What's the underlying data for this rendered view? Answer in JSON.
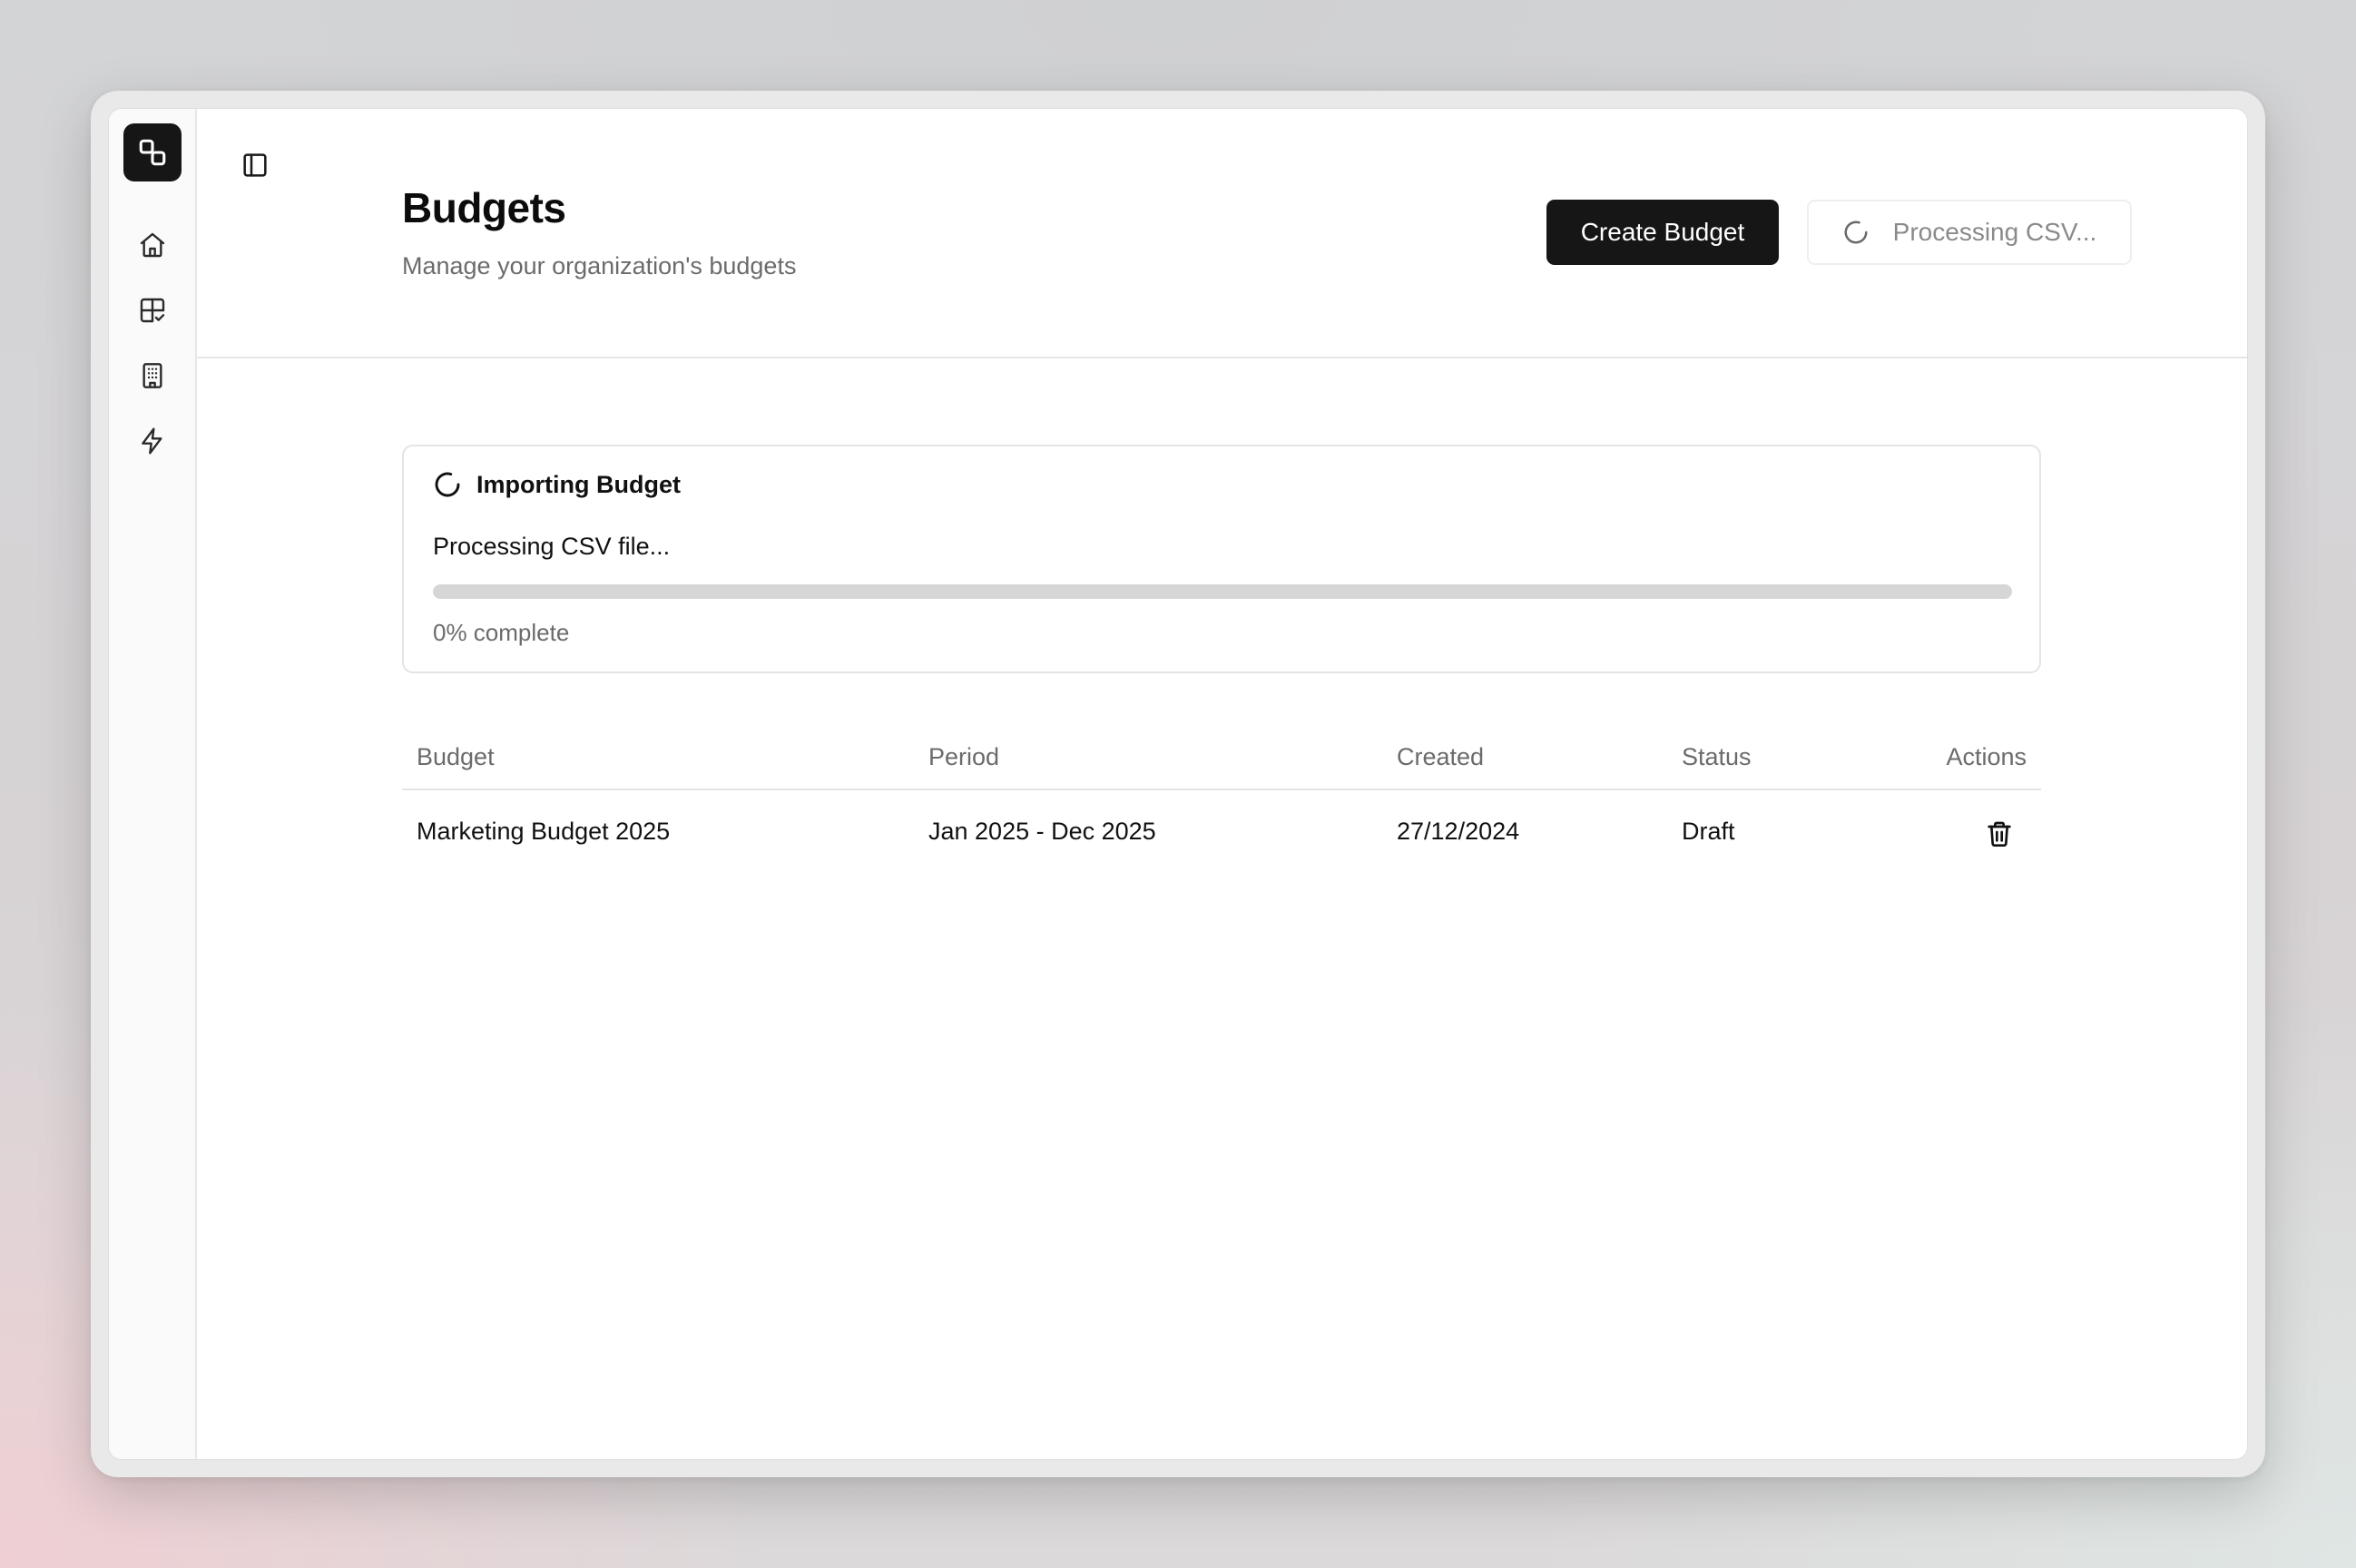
{
  "header": {
    "title": "Budgets",
    "subtitle": "Manage your organization's budgets",
    "create_label": "Create Budget",
    "processing_label": "Processing CSV..."
  },
  "nav": {
    "items": [
      {
        "name": "home",
        "icon": "home-icon"
      },
      {
        "name": "budgets",
        "icon": "layout-check-icon"
      },
      {
        "name": "organization",
        "icon": "building-icon"
      },
      {
        "name": "integrations",
        "icon": "zap-icon"
      }
    ]
  },
  "import": {
    "title": "Importing Budget",
    "message": "Processing CSV file...",
    "progress": 0,
    "progress_label": "0% complete"
  },
  "table": {
    "columns": [
      "Budget",
      "Period",
      "Created",
      "Status",
      "Actions"
    ],
    "rows": [
      {
        "budget": "Marketing Budget 2025",
        "period": "Jan 2025 - Dec 2025",
        "created": "27/12/2024",
        "status": "Draft"
      }
    ]
  },
  "colors": {
    "primary": "#161616",
    "muted_text": "#6b6b6b",
    "border": "#e4e4e4",
    "progress_track": "#d6d6d6"
  }
}
